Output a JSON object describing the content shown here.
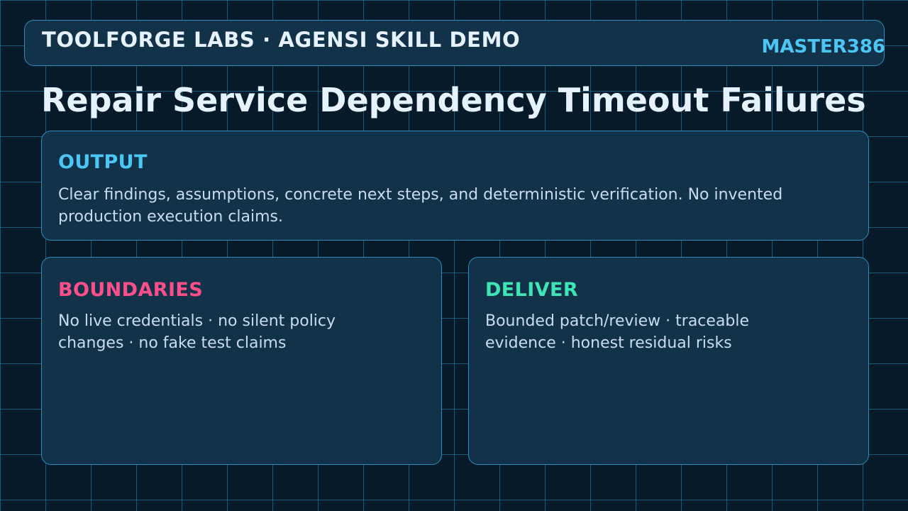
{
  "header": {
    "title": "TOOLFORGE LABS · AGENSI SKILL DEMO",
    "tag": "MASTER386"
  },
  "page": {
    "title": "Repair Service Dependency Timeout Failures"
  },
  "cards": {
    "output": {
      "heading": "OUTPUT",
      "body": "Clear findings, assumptions, concrete next steps, and deterministic verification. No invented production execution claims."
    },
    "boundaries": {
      "heading": "BOUNDARIES",
      "body": "No live credentials · no silent policy changes · no fake test claims"
    },
    "deliver": {
      "heading": "DELIVER",
      "body": "Bounded patch/review · traceable evidence · honest residual risks"
    }
  },
  "colors": {
    "background": "#061a29",
    "grid": "#268cbe",
    "panel": "#12324a",
    "panel_border": "#2d8cbc",
    "text_primary": "#e6f2ff",
    "text_body": "#c9dcef",
    "accent_output": "#4cc6f5",
    "accent_boundaries": "#ff4f8b",
    "accent_deliver": "#3ee6b5"
  }
}
